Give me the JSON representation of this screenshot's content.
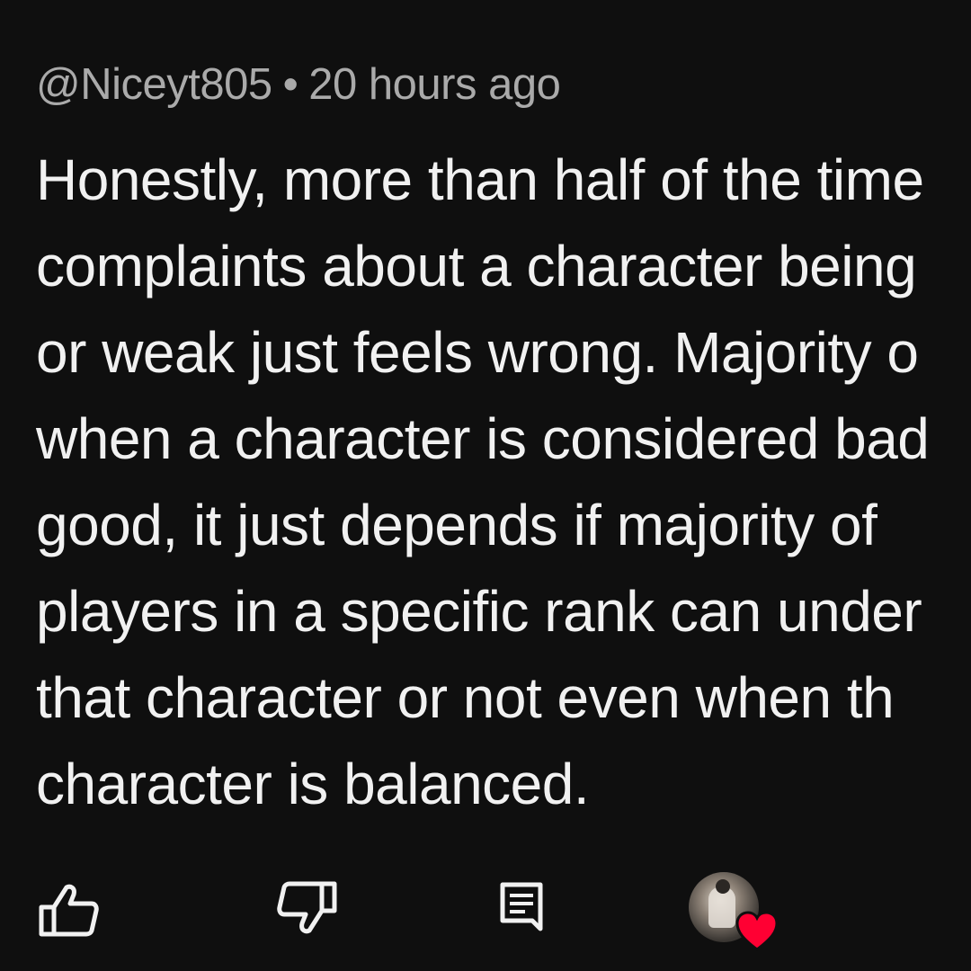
{
  "comment": {
    "author": "@Niceyt805",
    "separator": "•",
    "timestamp": "20 hours ago",
    "lines": [
      "Honestly, more than half of the time",
      "complaints about a character being",
      "or weak just feels wrong. Majority o",
      "when a character is considered bad",
      "good, it just depends if majority of",
      "players in a specific rank can under",
      "that character or not even when th",
      "character is balanced."
    ]
  },
  "actions": {
    "like_icon": "thumbs-up-icon",
    "dislike_icon": "thumbs-down-icon",
    "reply_icon": "reply-comment-icon",
    "creator_heart_icon": "heart-icon"
  },
  "colors": {
    "background": "#0f0f0f",
    "meta_text": "#aaaaaa",
    "body_text": "#f1f1f1",
    "heart": "#ff0033"
  }
}
